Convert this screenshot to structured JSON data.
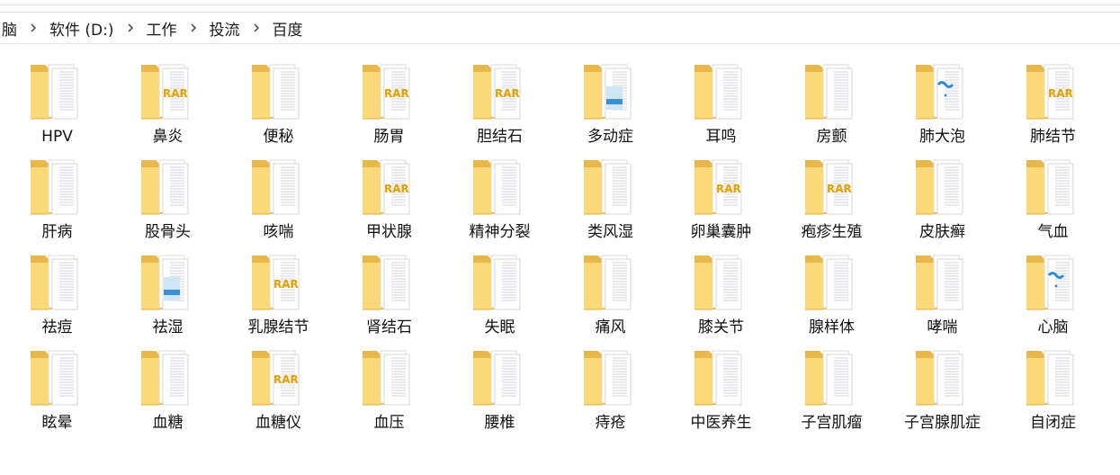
{
  "breadcrumb": [
    "脑",
    "软件 (D:)",
    "工作",
    "投流",
    "百度"
  ],
  "folders": [
    {
      "name": "HPV",
      "preview": "docs"
    },
    {
      "name": "鼻炎",
      "preview": "rar"
    },
    {
      "name": "便秘",
      "preview": "docs"
    },
    {
      "name": "肠胃",
      "preview": "rar"
    },
    {
      "name": "胆结石",
      "preview": "rar"
    },
    {
      "name": "多动症",
      "preview": "image"
    },
    {
      "name": "耳鸣",
      "preview": "docs"
    },
    {
      "name": "房颤",
      "preview": "docs"
    },
    {
      "name": "肺大泡",
      "preview": "video"
    },
    {
      "name": "肺结节",
      "preview": "rar"
    },
    {
      "name": "肝病",
      "preview": "docs"
    },
    {
      "name": "股骨头",
      "preview": "docs"
    },
    {
      "name": "咳喘",
      "preview": "docs"
    },
    {
      "name": "甲状腺",
      "preview": "rar"
    },
    {
      "name": "精神分裂",
      "preview": "docs"
    },
    {
      "name": "类风湿",
      "preview": "docs"
    },
    {
      "name": "卵巢囊肿",
      "preview": "rar"
    },
    {
      "name": "疱疹生殖",
      "preview": "rar"
    },
    {
      "name": "皮肤癣",
      "preview": "docs"
    },
    {
      "name": "气血",
      "preview": "docs"
    },
    {
      "name": "祛痘",
      "preview": "docs"
    },
    {
      "name": "祛湿",
      "preview": "image"
    },
    {
      "name": "乳腺结节",
      "preview": "rar"
    },
    {
      "name": "肾结石",
      "preview": "docs"
    },
    {
      "name": "失眠",
      "preview": "docs"
    },
    {
      "name": "痛风",
      "preview": "docs"
    },
    {
      "name": "膝关节",
      "preview": "docs"
    },
    {
      "name": "腺样体",
      "preview": "docs"
    },
    {
      "name": "哮喘",
      "preview": "docs"
    },
    {
      "name": "心脑",
      "preview": "video"
    },
    {
      "name": "眩晕",
      "preview": "docs"
    },
    {
      "name": "血糖",
      "preview": "docs"
    },
    {
      "name": "血糖仪",
      "preview": "rar"
    },
    {
      "name": "血压",
      "preview": "docs"
    },
    {
      "name": "腰椎",
      "preview": "docs"
    },
    {
      "name": "痔疮",
      "preview": "docs"
    },
    {
      "name": "中医养生",
      "preview": "docs"
    },
    {
      "name": "子宫肌瘤",
      "preview": "docs"
    },
    {
      "name": "子宫腺肌症",
      "preview": "docs"
    },
    {
      "name": "自闭症",
      "preview": "docs"
    }
  ],
  "colors": {
    "folder_back": "#e8b94a",
    "folder_front": "#fbd978",
    "rar_mark": "#e6a100",
    "video_mark": "#2b8bd8"
  }
}
